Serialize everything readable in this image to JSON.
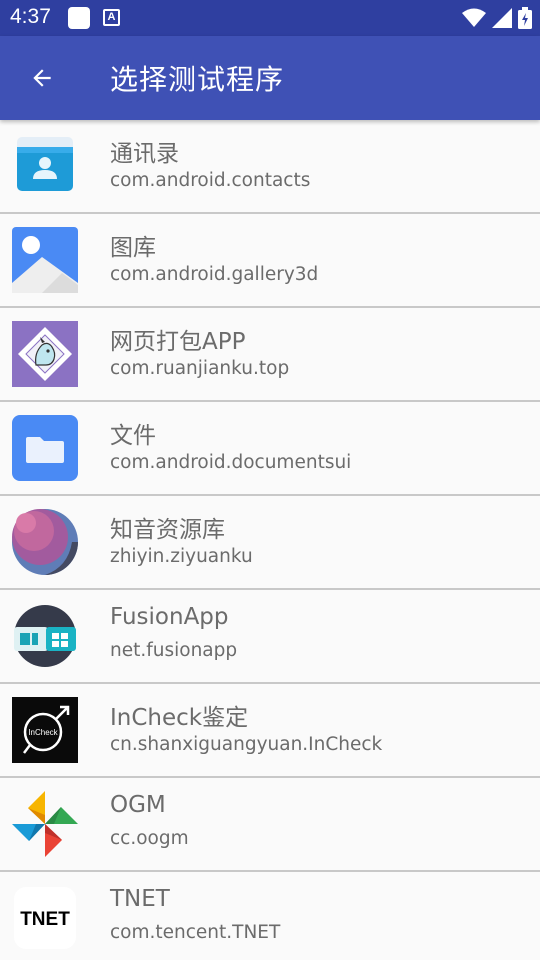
{
  "status_bar": {
    "time": "4:37",
    "notification_glyph": "A"
  },
  "app_bar": {
    "title": "选择测试程序",
    "back_icon": "arrow-back-icon"
  },
  "apps": [
    {
      "name": "通讯录",
      "package": "com.android.contacts",
      "icon": "contacts-icon"
    },
    {
      "name": "图库",
      "package": "com.android.gallery3d",
      "icon": "gallery-icon"
    },
    {
      "name": "网页打包APP",
      "package": "com.ruanjianku.top",
      "icon": "web-package-icon"
    },
    {
      "name": "文件",
      "package": "com.android.documentsui",
      "icon": "folder-icon"
    },
    {
      "name": "知音资源库",
      "package": "zhiyin.ziyuanku",
      "icon": "planet-icon"
    },
    {
      "name": "FusionApp",
      "package": "net.fusionapp",
      "icon": "fusionapp-icon"
    },
    {
      "name": "InCheck鉴定",
      "package": "cn.shanxiguangyuan.InCheck",
      "icon": "incheck-icon",
      "icon_text": "InCheck"
    },
    {
      "name": "OGM",
      "package": "cc.oogm",
      "icon": "pinwheel-icon"
    },
    {
      "name": "TNET",
      "package": "com.tencent.TNET",
      "icon": "tnet-icon",
      "icon_text": "TNET"
    }
  ],
  "colors": {
    "status_bar": "#2f3fa0",
    "app_bar": "#3f51b5",
    "list_bg": "#fafafa",
    "text": "#6b6b6b",
    "divider": "#c8c8c8"
  }
}
